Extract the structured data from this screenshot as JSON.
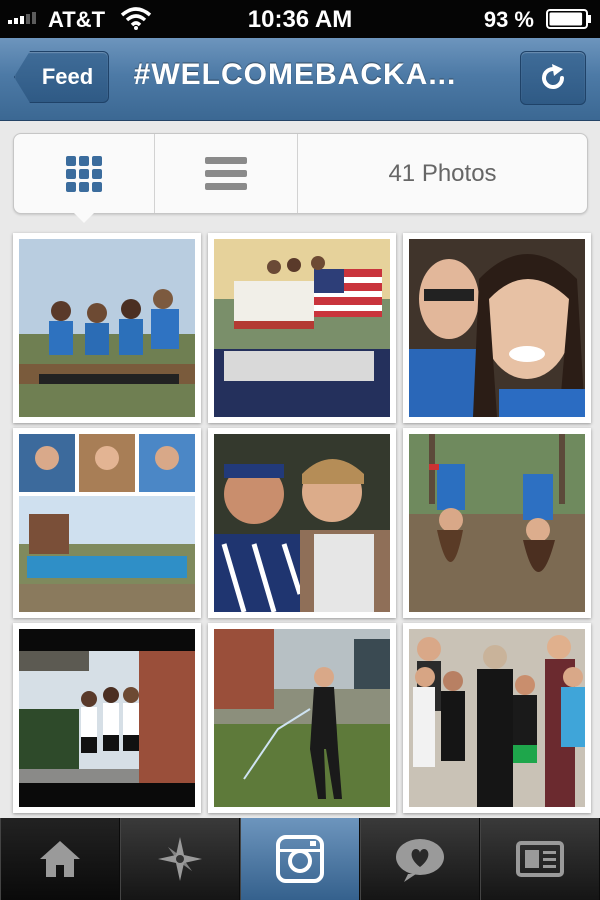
{
  "status_bar": {
    "carrier": "AT&T",
    "time": "10:36 AM",
    "battery_percent": "93 %",
    "battery_level": 0.93
  },
  "nav": {
    "back_label": "Feed",
    "title": "#WELCOMEBACKA..."
  },
  "view_toggle": {
    "selected": "grid",
    "photo_count_label": "41 Photos"
  },
  "tab_bar": {
    "items": [
      "home-icon",
      "explore-star-icon",
      "camera-icon",
      "activity-heart-icon",
      "profile-card-icon"
    ],
    "selected": "camera-icon"
  },
  "colors": {
    "nav_blue": "#4d7aa6",
    "grid_icon_blue": "#3b6c9d",
    "tab_bar_dark": "#1a1a1a"
  }
}
